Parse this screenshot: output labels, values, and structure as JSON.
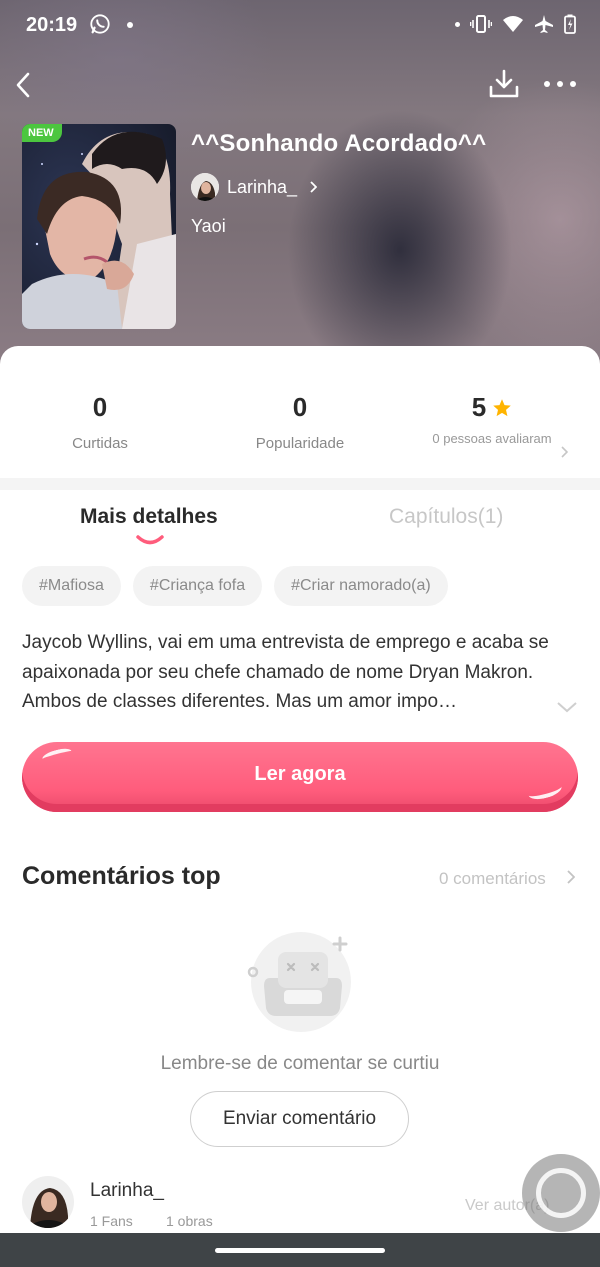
{
  "status_bar": {
    "time": "20:19"
  },
  "book": {
    "badge": "NEW",
    "title": "^^Sonhando Acordado^^",
    "author": "Larinha_",
    "genre": "Yaoi"
  },
  "stats": {
    "likes_value": "0",
    "likes_label": "Curtidas",
    "popularity_value": "0",
    "popularity_label": "Popularidade",
    "rating_value": "5",
    "rating_label": "0 pessoas avaliaram"
  },
  "tabs": [
    {
      "label": "Mais detalhes",
      "active": true
    },
    {
      "label": "Capítulos(1)",
      "active": false
    }
  ],
  "tags": [
    "#Mafiosa",
    "#Criança fofa",
    "#Criar namorado(a)"
  ],
  "synopsis": "Jaycob Wyllins, vai em uma entrevista de emprego e acaba se apaixonada por seu chefe chamado de nome Dryan Makron. Ambos de classes diferentes. Mas um amor impo…",
  "read_button": "Ler agora",
  "comments": {
    "title": "Comentários top",
    "count": "0 comentários",
    "empty_text": "Lembre-se de comentar se curtiu",
    "send_button": "Enviar comentário"
  },
  "author_card": {
    "name": "Larinha_",
    "fans": "1 Fans",
    "works": "1 obras",
    "link": "Ver autor(a)"
  },
  "colors": {
    "accent": "#ff5c7c",
    "badge_green": "#4cc63f",
    "star": "#ffb400"
  }
}
